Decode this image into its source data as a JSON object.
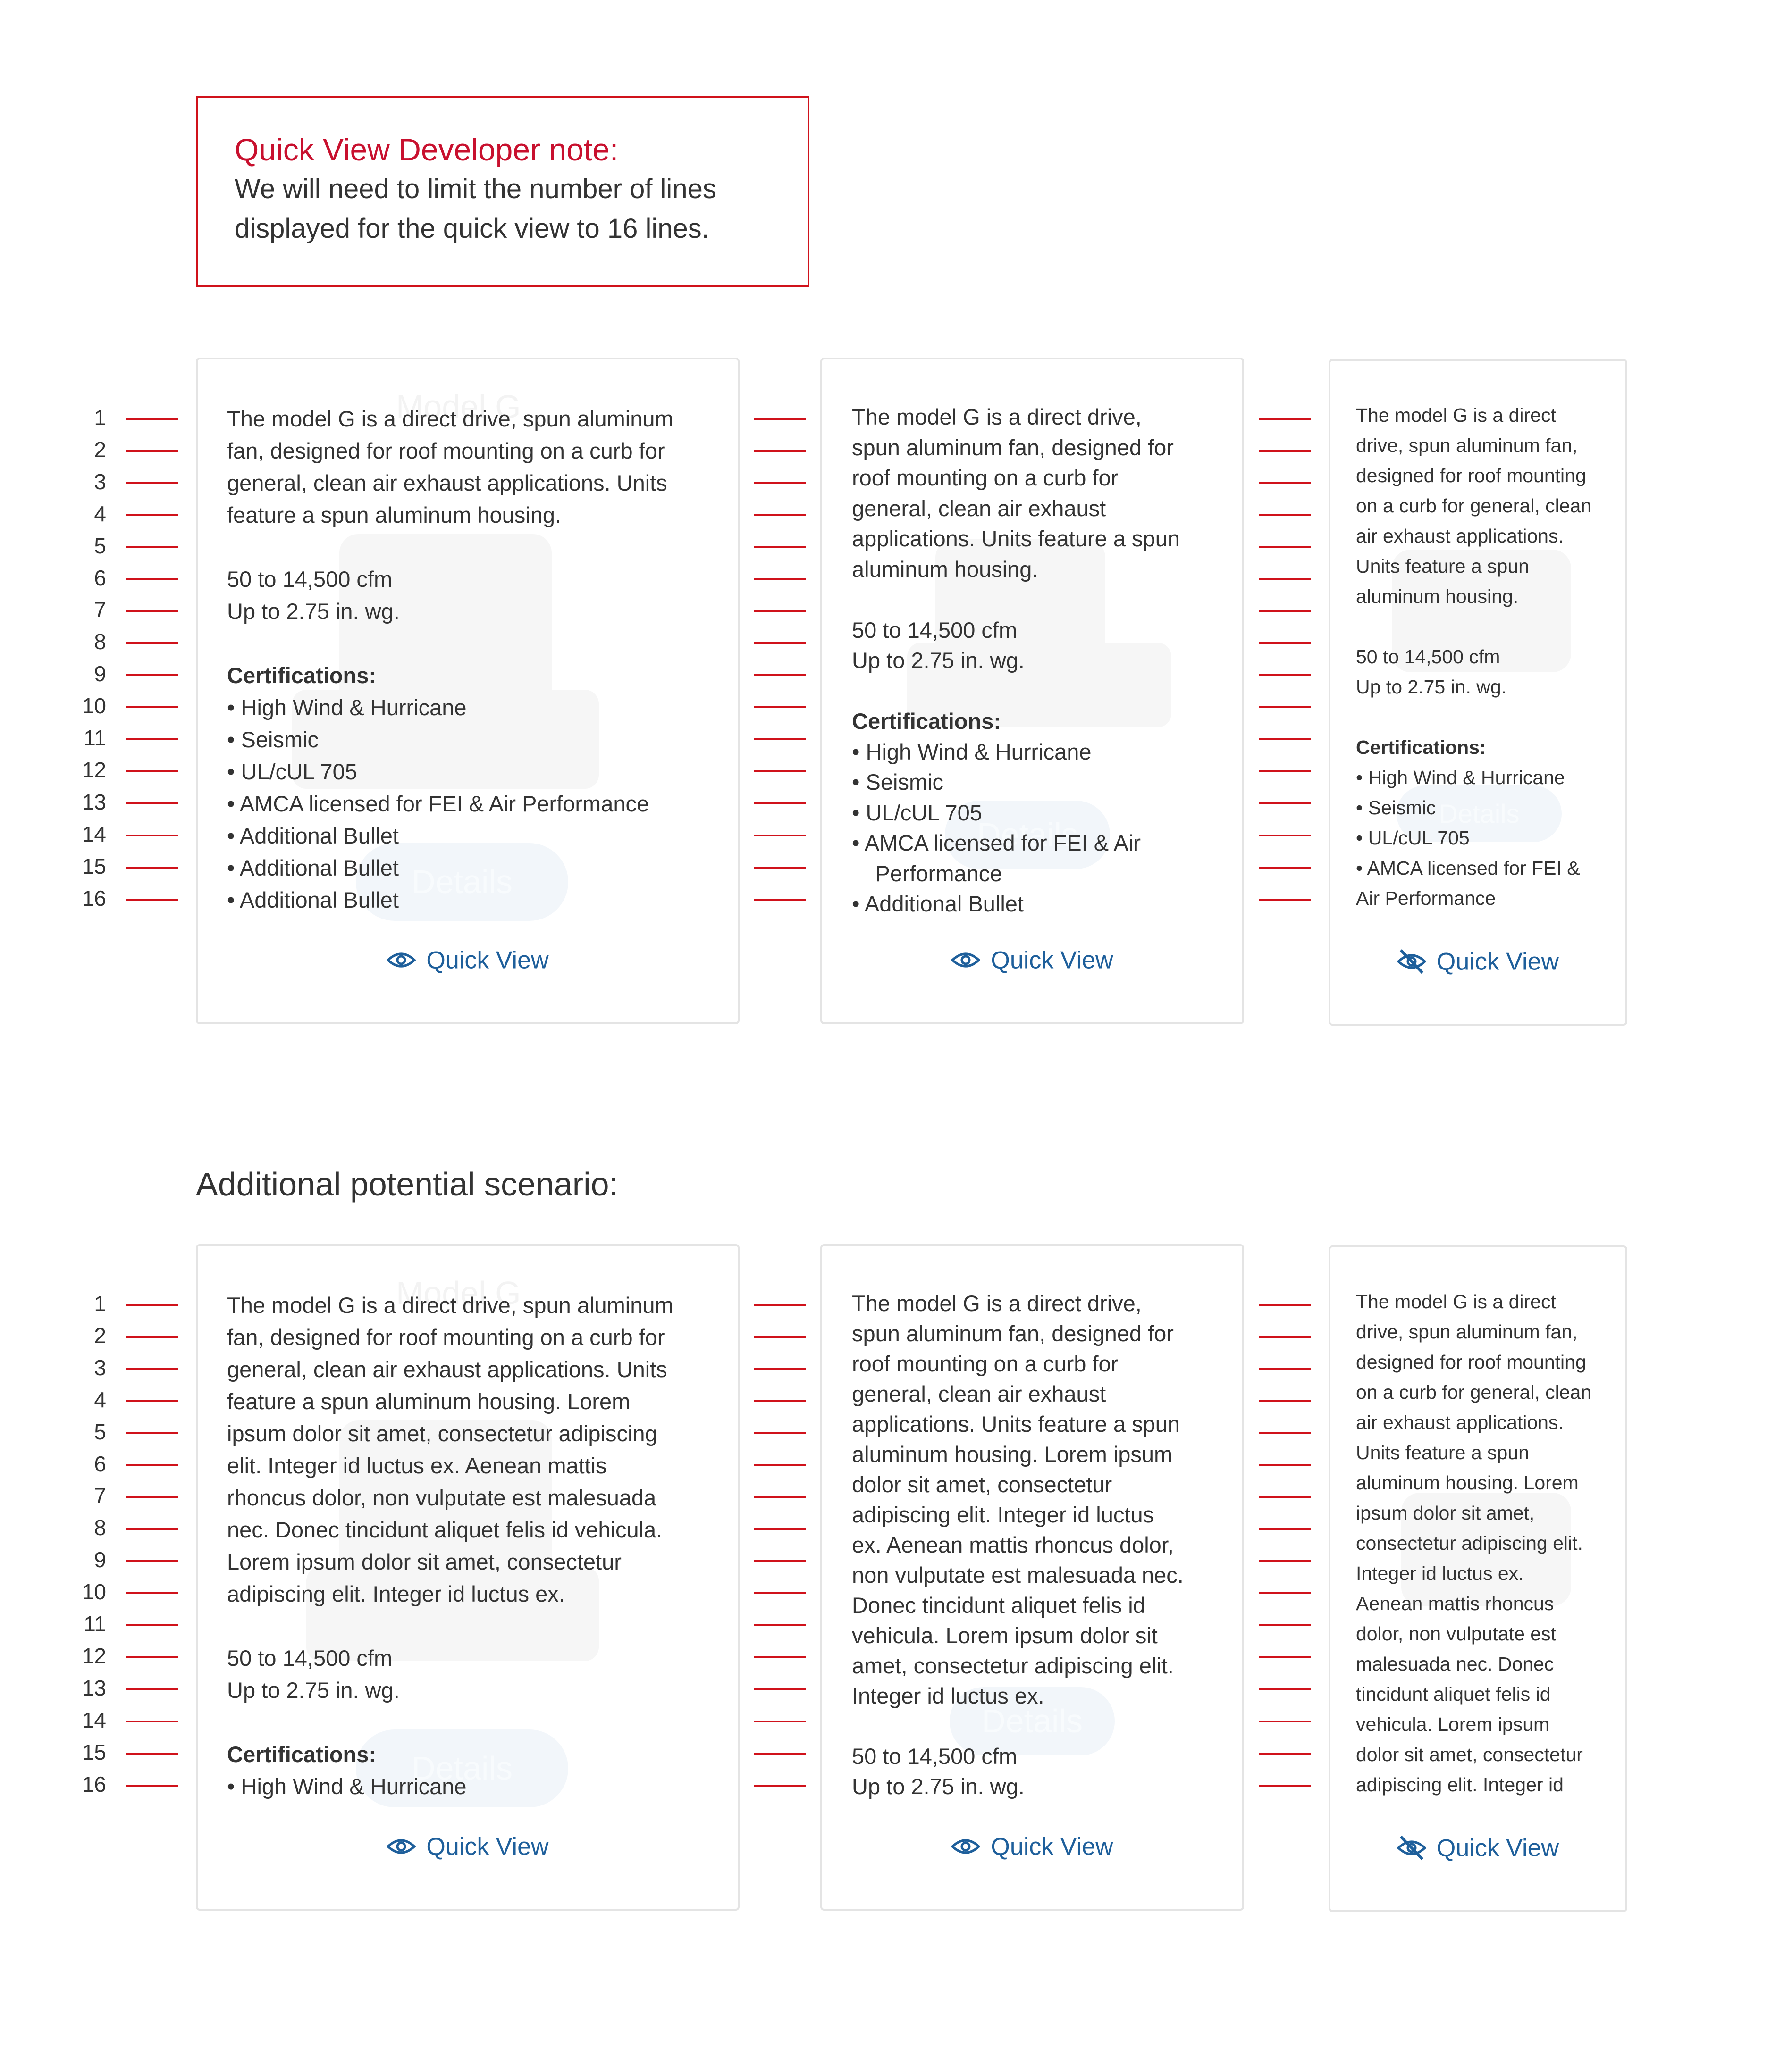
{
  "note": {
    "title": "Quick View Developer note:",
    "body_line1": "We will need to limit the number of lines",
    "body_line2": "displayed for the quick view to 16 lines."
  },
  "section_title": "Additional potential scenario:",
  "quick_view_label": "Quick View",
  "line_numbers": [
    "1",
    "2",
    "3",
    "4",
    "5",
    "6",
    "7",
    "8",
    "9",
    "10",
    "11",
    "12",
    "13",
    "14",
    "15",
    "16"
  ],
  "ghost": {
    "model_title": "Model G",
    "details_button": "Details"
  },
  "row1": {
    "card_large": {
      "description": [
        "The model G is a direct drive, spun aluminum",
        "fan, designed for roof mounting on a curb for",
        "general, clean air exhaust applications. Units",
        "feature a spun aluminum housing."
      ],
      "specs": [
        "50 to 14,500 cfm",
        "Up to 2.75 in. wg."
      ],
      "certifications_label": "Certifications:",
      "bullets": [
        "• High Wind & Hurricane",
        "• Seismic",
        "• UL/cUL 705",
        "• AMCA licensed for FEI & Air Performance",
        "• Additional Bullet",
        "• Additional Bullet",
        "• Additional Bullet"
      ]
    },
    "card_medium": {
      "description": [
        "The model G is a direct drive,",
        "spun aluminum fan, designed for",
        "roof mounting on a curb for",
        "general, clean air exhaust",
        "applications. Units feature a spun",
        "aluminum housing."
      ],
      "specs": [
        "50 to 14,500 cfm",
        "Up to 2.75 in. wg."
      ],
      "certifications_label": "Certifications:",
      "bullets": [
        "• High Wind & Hurricane",
        "• Seismic",
        "• UL/cUL 705",
        "• AMCA licensed for FEI & Air Performance",
        "• Additional Bullet"
      ]
    },
    "card_small": {
      "description": [
        "The model G is a direct",
        "drive, spun aluminum fan,",
        "designed for roof mounting",
        "on a curb for general, clean",
        "air exhaust applications.",
        "Units feature a spun",
        "aluminum housing."
      ],
      "specs": [
        "50 to 14,500 cfm",
        "Up to 2.75 in. wg."
      ],
      "certifications_label": "Certifications:",
      "bullets": [
        "• High Wind & Hurricane",
        "• Seismic",
        "• UL/cUL 705",
        "• AMCA licensed for FEI &",
        "Air Performance"
      ]
    }
  },
  "row2": {
    "card_large": {
      "description": [
        "The model G is a direct drive, spun aluminum",
        "fan, designed for roof mounting on a curb for",
        "general, clean air exhaust applications. Units",
        "feature a spun aluminum housing. Lorem",
        "ipsum dolor sit amet, consectetur adipiscing",
        "elit. Integer id luctus ex. Aenean mattis",
        "rhoncus dolor, non vulputate est malesuada",
        "nec. Donec tincidunt aliquet felis id vehicula.",
        "Lorem ipsum dolor sit amet, consectetur",
        "adipiscing elit. Integer id luctus ex."
      ],
      "specs": [
        "50 to 14,500 cfm",
        "Up to 2.75 in. wg."
      ],
      "certifications_label": "Certifications:",
      "bullets": [
        "• High Wind & Hurricane"
      ]
    },
    "card_medium": {
      "description": [
        "The model G is a direct drive,",
        "spun aluminum fan, designed for",
        "roof mounting on a curb for",
        "general, clean air exhaust",
        "applications. Units feature a spun",
        "aluminum housing. Lorem ipsum",
        "dolor sit amet, consectetur",
        "adipiscing elit. Integer id luctus",
        "ex. Aenean mattis rhoncus dolor,",
        "non vulputate est malesuada nec.",
        "Donec tincidunt aliquet felis id",
        "vehicula. Lorem ipsum dolor sit",
        "amet, consectetur adipiscing elit.",
        "Integer id luctus ex."
      ],
      "specs": [
        "50 to 14,500 cfm",
        "Up to 2.75 in. wg."
      ]
    },
    "card_small": {
      "description": [
        "The model G is a direct",
        "drive, spun aluminum fan,",
        "designed for roof mounting",
        "on a curb for general, clean",
        "air exhaust applications.",
        "Units feature a spun",
        "aluminum housing. Lorem",
        "ipsum dolor sit amet,",
        "consectetur adipiscing elit.",
        "Integer id luctus ex.",
        "Aenean mattis rhoncus",
        "dolor, non vulputate est",
        "malesuada nec. Donec",
        "tincidunt aliquet felis id",
        "vehicula. Lorem ipsum",
        "dolor sit amet, consectetur",
        "adipiscing elit. Integer id"
      ]
    }
  },
  "colors": {
    "accent_red": "#d0121b",
    "link_blue": "#1e5f9b",
    "text": "#333333",
    "border": "#e4e4e4"
  },
  "icons": {
    "quick_view_open": "eye-icon",
    "quick_view_closed": "eye-off-icon"
  }
}
